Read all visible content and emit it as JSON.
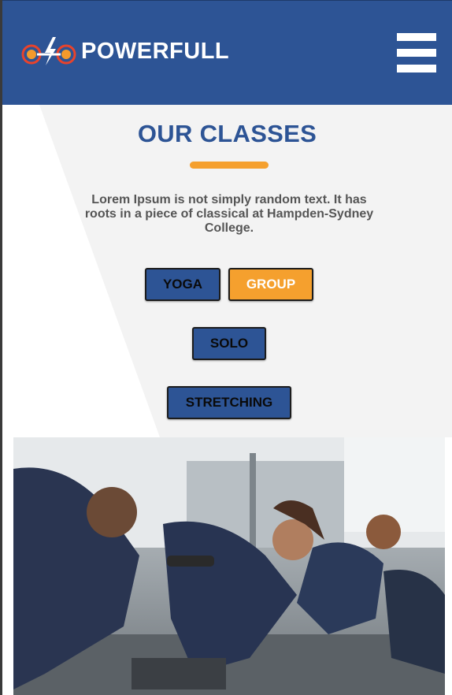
{
  "header": {
    "brand": "POWERFULL",
    "colors": {
      "primary": "#2d5495",
      "accent": "#f5a02e"
    },
    "menu_icon": "hamburger-menu-icon"
  },
  "classes": {
    "title": "OUR CLASSES",
    "description": "Lorem Ipsum is not simply random text. It has roots in a piece of classical at Hampden-Sydney College.",
    "filters": [
      {
        "label": "YOGA",
        "active": false
      },
      {
        "label": "GROUP",
        "active": true
      },
      {
        "label": "SOLO",
        "active": false
      },
      {
        "label": "STRETCHING",
        "active": false
      }
    ]
  }
}
